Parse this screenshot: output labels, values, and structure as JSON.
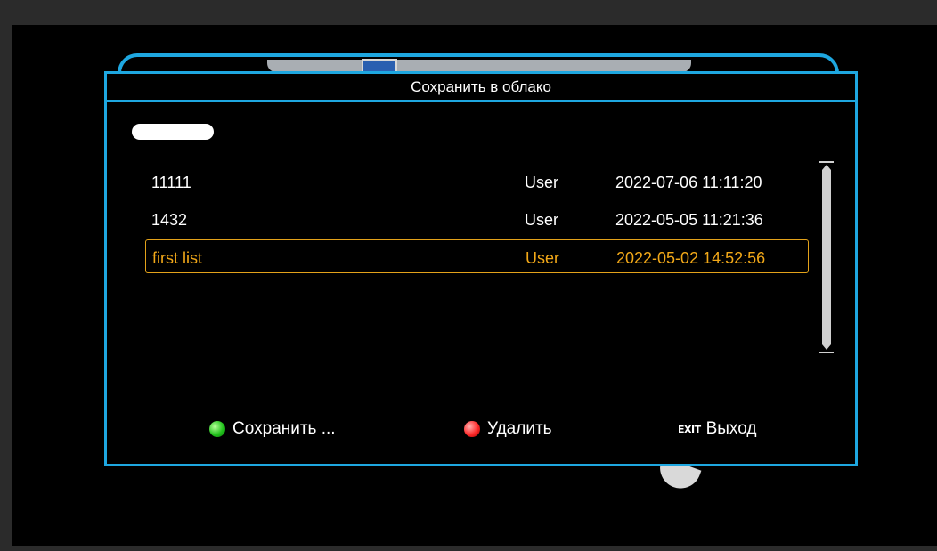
{
  "dialog": {
    "title": "Сохранить в облако"
  },
  "list": {
    "rows": [
      {
        "name": "11111",
        "user": "User",
        "date": "2022-07-06 11:11:20",
        "selected": false
      },
      {
        "name": "1432",
        "user": "User",
        "date": "2022-05-05 11:21:36",
        "selected": false
      },
      {
        "name": "first list",
        "user": "User",
        "date": "2022-05-02 14:52:56",
        "selected": true
      }
    ]
  },
  "footer": {
    "save_label": "Сохранить ...",
    "delete_label": "Удалить",
    "exit_icon_text": "EXIT",
    "exit_label": "Выход"
  },
  "colors": {
    "frame": "#1ea7e0",
    "highlight": "#f2a818",
    "background": "#000000"
  },
  "icons": [
    "green-key-icon",
    "red-key-icon",
    "exit-key-icon",
    "scrollbar"
  ]
}
